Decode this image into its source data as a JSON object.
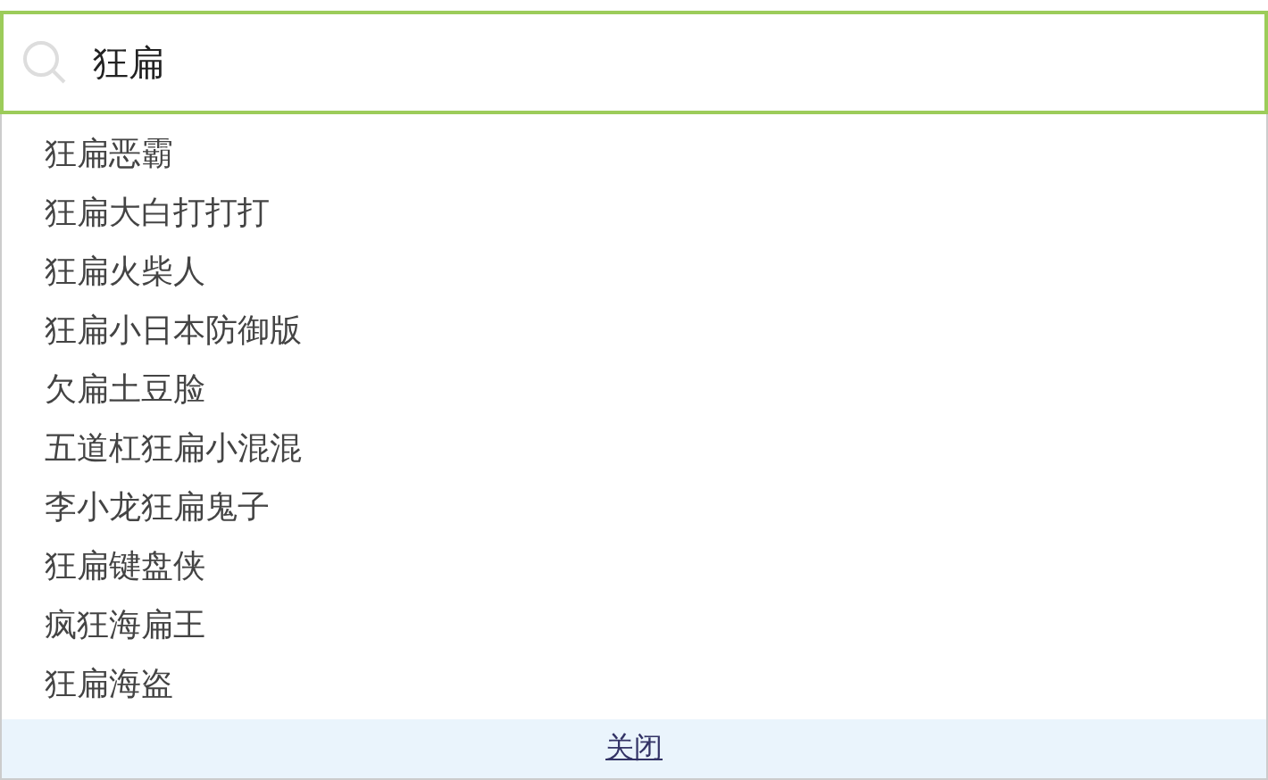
{
  "search": {
    "value": "狂扁"
  },
  "suggestions": [
    "狂扁恶霸",
    "狂扁大白打打打",
    "狂扁火柴人",
    "狂扁小日本防御版",
    "欠扁土豆脸",
    "五道杠狂扁小混混",
    "李小龙狂扁鬼子",
    "狂扁键盘侠",
    "疯狂海扁王",
    "狂扁海盗"
  ],
  "close_link": "关闭"
}
